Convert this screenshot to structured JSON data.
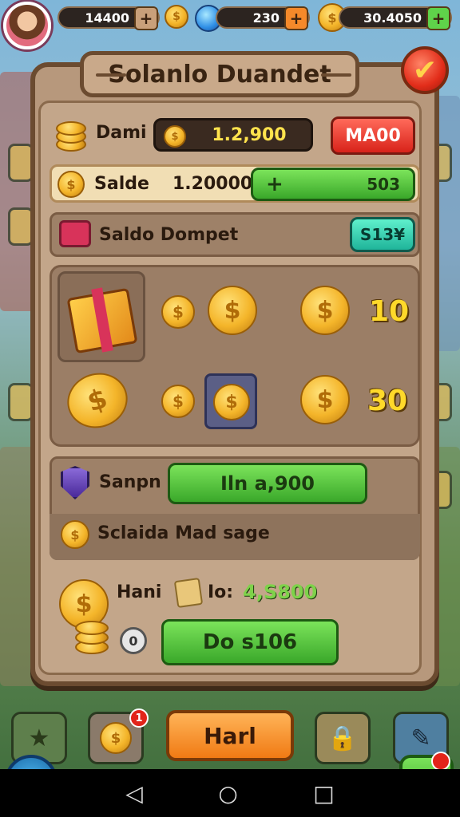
{
  "hud": {
    "coins_value": "14400",
    "gems_value": "230",
    "gold_value": "30.4050",
    "plus_symbol": "+"
  },
  "panel": {
    "title": "Solanlo Duandet",
    "confirm_icon": "checkmark-icon"
  },
  "rows": {
    "dami_label": "Dami",
    "dami_value": "1.2,900",
    "max_button": "MA00",
    "saldo_label": "Salde",
    "saldo_value": "1.20000",
    "saldo_add": "+",
    "saldo_green_value": "503",
    "dompet_label": "Saldo Dompet",
    "dompet_button": "S13¥"
  },
  "rewards": {
    "row1_value": "10",
    "row2_value": "30"
  },
  "lower": {
    "sanpn_label": "Sanpn",
    "sanpn_button": "Iln a,900",
    "message_label": "Sclaida Mad sage"
  },
  "bottom_section": {
    "hani_label": "Hani",
    "do_label": "Io:",
    "do_value": "4,S800",
    "zero_label": "0",
    "deposit_button": "Do s106"
  },
  "bottombar": {
    "main_button": "Harl",
    "badge_count": "1"
  },
  "colors": {
    "panel": "#b7987c",
    "accent_green": "#3aa82a",
    "accent_red": "#d8231a",
    "gold": "#ffd92a"
  }
}
